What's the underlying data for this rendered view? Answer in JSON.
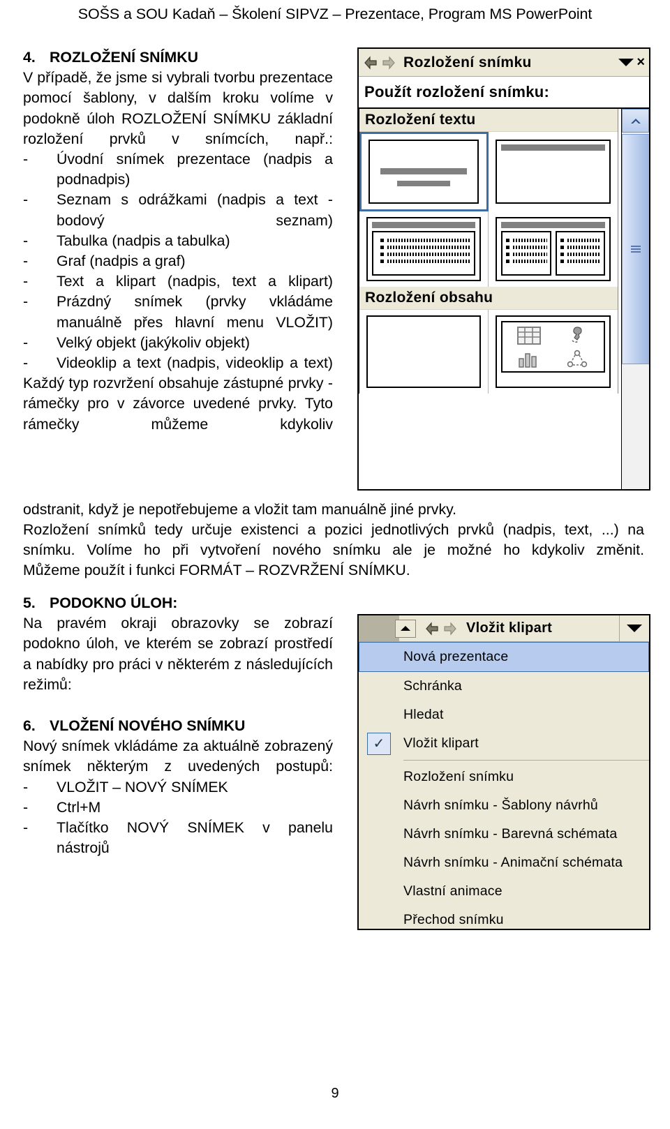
{
  "header": {
    "title": "SOŠS a SOU Kadaň – Školení SIPVZ – Prezentace, Program MS PowerPoint"
  },
  "page_number": "9",
  "sections": {
    "s4": {
      "number": "4.",
      "title": "ROZLOŽENÍ SNÍMKU",
      "intro": "V případě, že jsme si vybrali tvorbu prezentace pomocí šablony, v dalším kroku volíme v podokně úloh ROZLOŽENÍ SNÍMKU základní rozložení prvků v snímcích, např.:",
      "bullets": [
        "Úvodní snímek prezentace (nadpis a podnadpis)",
        "Seznam s odrážkami (nadpis a text - bodový seznam)",
        "Tabulka (nadpis a tabulka)",
        "Graf (nadpis a graf)",
        "Text a klipart (nadpis, text a klipart)",
        "Prázdný snímek (prvky vkládáme manuálně přes hlavní menu VLOŽIT)",
        "Velký objekt (jakýkoliv objekt)",
        "Videoklip a text (nadpis, videoklip a text)"
      ],
      "bullet_marker": "-",
      "para_narrow": "Každý typ rozvržení obsahuje zástupné prvky - rámečky pro v závorce uvedené prvky. Tyto rámečky můžeme kdykoliv",
      "para_wide_1": "odstranit, když je nepotřebujeme a vložit tam manuálně jiné prvky.",
      "para_wide_2": "Rozložení snímků tedy určuje existenci a pozici jednotlivých prvků (nadpis, text, ...) na snímku. Volíme ho při vytvoření nového snímku ale je možné ho kdykoliv změnit.",
      "para_wide_3": "Můžeme použít i funkci FORMÁT – ROZVRŽENÍ SNÍMKU."
    },
    "s5": {
      "number": "5.",
      "title": "PODOKNO ÚLOH:",
      "body": "Na pravém okraji obrazovky se zobrazí podokno úloh, ve kterém se zobrazí prostředí a nabídky pro práci v některém z následujících režimů:"
    },
    "s6": {
      "number": "6.",
      "title": "VLOŽENÍ NOVÉHO SNÍMKU",
      "body": "Nový snímek vkládáme za aktuálně zobrazený snímek některým z uvedených postupů:",
      "bullet_marker": "-",
      "bullets": [
        "VLOŽIT – NOVÝ SNÍMEK",
        "Ctrl+M",
        "Tlačítko NOVÝ SNÍMEK v panelu nástrojů"
      ]
    }
  },
  "screenshot_layout_pane": {
    "title": "Rozložení snímku",
    "close_label": "×",
    "subtitle": "Použít rozložení snímku:",
    "groups": [
      {
        "label": "Rozložení textu"
      },
      {
        "label": "Rozložení obsahu"
      }
    ],
    "icons": {
      "back": "back-arrow-icon",
      "forward": "forward-arrow-icon",
      "dropdown": "chevron-down-icon",
      "scroll_up": "scroll-up-arrow-icon"
    },
    "layout_thumbnails": [
      {
        "name": "Úvodní snímek",
        "selected": true
      },
      {
        "name": "Pouze nadpis",
        "selected": false
      },
      {
        "name": "Nadpis a text",
        "selected": false
      },
      {
        "name": "Nadpis a text ve dvou sloupcích",
        "selected": false
      },
      {
        "name": "Prázdný",
        "selected": false
      },
      {
        "name": "Nadpis a obsah",
        "selected": false
      }
    ]
  },
  "screenshot_task_menu": {
    "title": "Vložit klipart",
    "icons": {
      "back": "back-arrow-icon",
      "forward": "forward-arrow-icon",
      "dropdown": "chevron-down-icon",
      "scroll_up": "scroll-up-arrow-icon",
      "checkmark": "check-icon"
    },
    "items": [
      {
        "label": "Nová prezentace",
        "highlighted": true,
        "checked": false,
        "separator_after": false
      },
      {
        "label": "Schránka",
        "highlighted": false,
        "checked": false,
        "separator_after": false
      },
      {
        "label": "Hledat",
        "highlighted": false,
        "checked": false,
        "separator_after": false
      },
      {
        "label": "Vložit klipart",
        "highlighted": false,
        "checked": true,
        "separator_after": true
      },
      {
        "label": "Rozložení snímku",
        "highlighted": false,
        "checked": false,
        "separator_after": false
      },
      {
        "label": "Návrh snímku - Šablony návrhů",
        "highlighted": false,
        "checked": false,
        "separator_after": false
      },
      {
        "label": "Návrh snímku - Barevná schémata",
        "highlighted": false,
        "checked": false,
        "separator_after": false
      },
      {
        "label": "Návrh snímku - Animační schémata",
        "highlighted": false,
        "checked": false,
        "separator_after": false
      },
      {
        "label": "Vlastní animace",
        "highlighted": false,
        "checked": false,
        "separator_after": false
      },
      {
        "label": "Přechod snímku",
        "highlighted": false,
        "checked": false,
        "separator_after": false
      }
    ]
  },
  "colors": {
    "chrome": "#ece9d8",
    "highlight": "#b6cbed",
    "selection_border": "#3a6ea5",
    "placeholder_gray": "#808080"
  }
}
